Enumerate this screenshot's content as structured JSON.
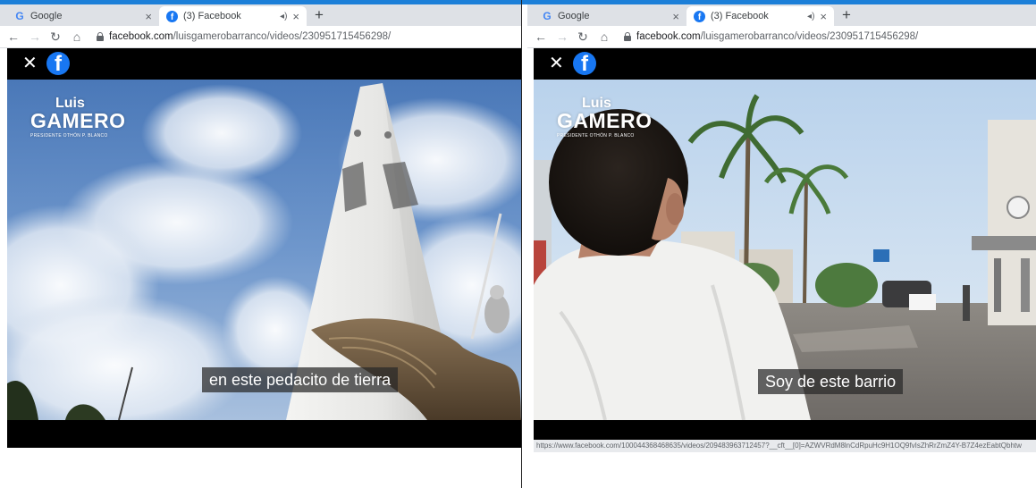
{
  "panels": [
    {
      "tabs": [
        {
          "title": "Google",
          "icon": "google-icon",
          "active": false
        },
        {
          "title": "(3) Facebook",
          "icon": "facebook-icon",
          "active": true
        }
      ],
      "address": {
        "host": "facebook.com",
        "path": "/luisgamerobarranco/videos/230951715456298/"
      },
      "watermark": {
        "first": "Luis",
        "last": "GAMERO",
        "role": "PRESIDENTE OTHÓN P. BLANCO"
      },
      "subtitle": "en este pedacito de tierra"
    },
    {
      "tabs": [
        {
          "title": "Google",
          "icon": "google-icon",
          "active": false
        },
        {
          "title": "(3) Facebook",
          "icon": "facebook-icon",
          "active": true
        }
      ],
      "address": {
        "host": "facebook.com",
        "path": "/luisgamerobarranco/videos/230951715456298/"
      },
      "watermark": {
        "first": "Luis",
        "last": "GAMERO",
        "role": "PRESIDENTE OTHÓN P. BLANCO"
      },
      "subtitle": "Soy de este barrio",
      "status_url": "https://www.facebook.com/100044368468635/videos/209483963712457?__cft__[0]=AZWVRdM8lnCdRpuHc9H1OQ9fvIsZhRrZmZ4Y-B7Z4ezEabtQbhtw"
    }
  ],
  "icons": {
    "close": "close-icon",
    "facebook": "facebook-logo-icon",
    "lock": "lock-icon",
    "back": "back-arrow-icon",
    "forward": "forward-arrow-icon",
    "reload": "reload-icon",
    "home": "home-icon"
  },
  "colors": {
    "facebook_blue": "#1877f2",
    "top_strip": "#1c7fd8",
    "tab_strip": "#dee1e6"
  }
}
